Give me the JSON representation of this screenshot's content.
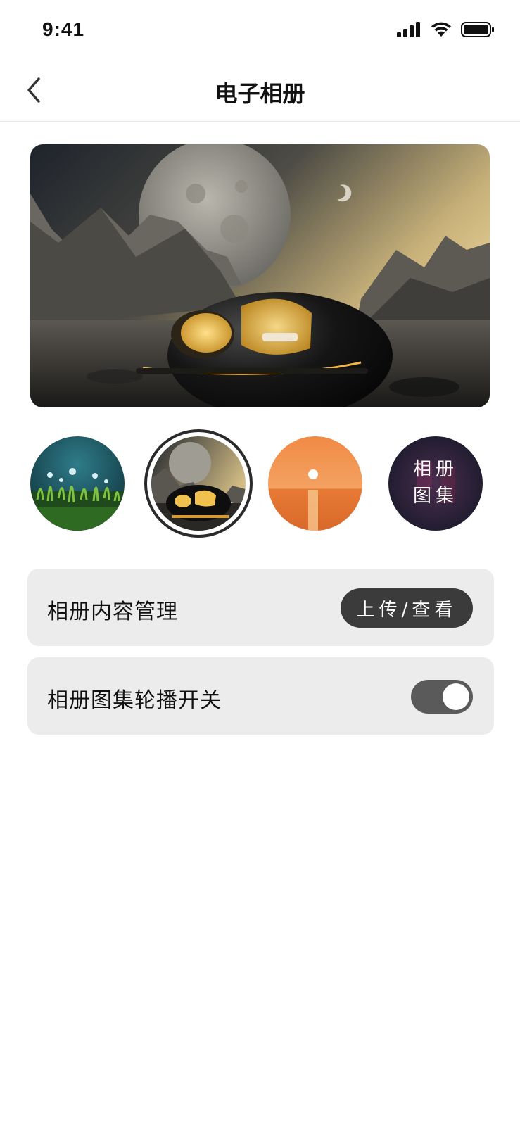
{
  "status_bar": {
    "time": "9:41",
    "icons": [
      "signal-icon",
      "wifi-icon",
      "battery-icon"
    ]
  },
  "nav": {
    "back_icon": "chevron-left-icon",
    "title": "电子相册"
  },
  "hero_image": {
    "description_icon": "moon-capsule-image"
  },
  "thumbnails": [
    {
      "name": "moss-dew-thumbnail",
      "selected": false,
      "label": ""
    },
    {
      "name": "moon-capsule-thumbnail",
      "selected": true,
      "label": ""
    },
    {
      "name": "sunset-sea-thumbnail",
      "selected": false,
      "label": ""
    },
    {
      "name": "album-gallery-thumbnail",
      "selected": false,
      "label": "相册\n图集"
    }
  ],
  "settings": {
    "content_manage": {
      "label": "相册内容管理",
      "button_label": "上传/查看"
    },
    "carousel_switch": {
      "label": "相册图集轮播开关",
      "enabled": true
    }
  },
  "colors": {
    "row_background": "#ececec",
    "pill_background": "#3b3b3b",
    "toggle_on": "#5a5a5a"
  }
}
